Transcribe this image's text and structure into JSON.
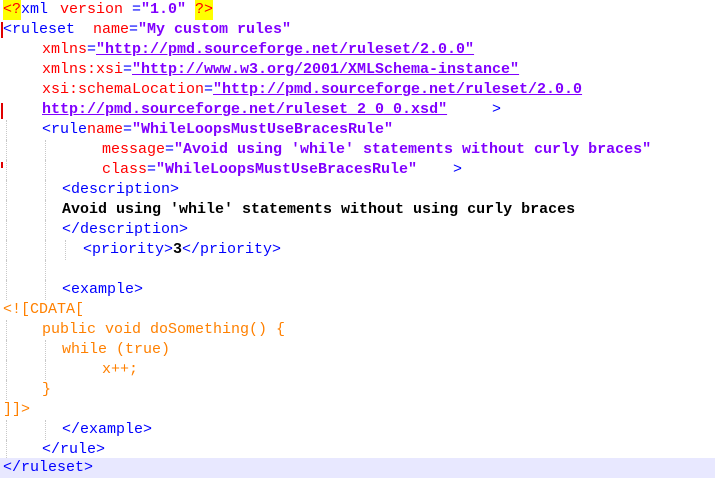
{
  "colors": {
    "tag": "#0000ff",
    "attribute": "#ff0000",
    "value": "#8000ff",
    "text": "#000000",
    "cdata": "#ff8000",
    "pi_highlight": "#ffff00",
    "current_line": "#e8e8ff",
    "change_marker": "#e00000"
  },
  "xml_decl": {
    "open": "<?",
    "name": "xml",
    "attr": "version",
    "eq": "=",
    "value": "\"1.0\"",
    "close": "?>"
  },
  "ruleset": {
    "open": "<ruleset",
    "name_attr": "name",
    "name_value": "\"My custom rules\"",
    "xmlns_attr": "xmlns",
    "xmlns_value": "\"http://pmd.sourceforge.net/ruleset/2.0.0\"",
    "xmlns_xsi_attr": "xmlns:xsi",
    "xmlns_xsi_value": "\"http://www.w3.org/2001/XMLSchema-instance\"",
    "schema_attr": "xsi:schemaLocation",
    "schema_value_1": "\"http://pmd.sourceforge.net/ruleset/2.0.0",
    "schema_value_2": "http://pmd.sourceforge.net/ruleset_2_0_0.xsd\"",
    "gt": ">",
    "close": "</ruleset>"
  },
  "rule": {
    "open": "<rule",
    "name_attr": "name",
    "name_value": "\"WhileLoopsMustUseBracesRule\"",
    "message_attr": "message",
    "message_value": "\"Avoid using 'while' statements without curly braces\"",
    "class_attr": "class",
    "class_value": "\"WhileLoopsMustUseBracesRule\"",
    "gt": ">",
    "close": "</rule>",
    "description_open": "<description>",
    "description_text": "Avoid using 'while' statements without using curly braces",
    "description_close": "</description>",
    "priority_open": "<priority>",
    "priority_value": "3",
    "priority_close": "</priority>",
    "example_open": "<example>",
    "example_close": "</example>"
  },
  "cdata": {
    "open": "<![CDATA[",
    "line1": "public void doSomething() {",
    "line2": "while (true)",
    "line3": "x++;",
    "line4": "}",
    "close": "]]>"
  }
}
